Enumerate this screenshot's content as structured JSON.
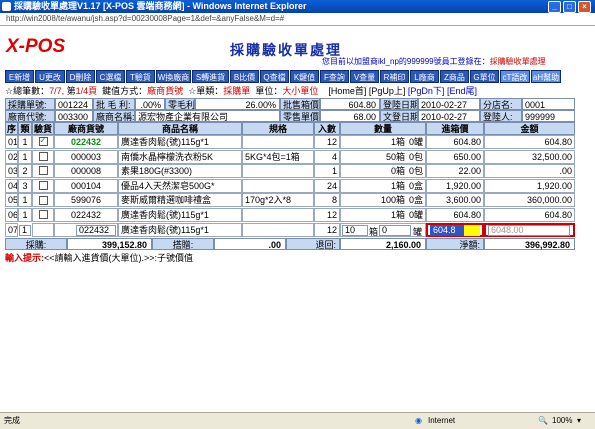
{
  "window": {
    "title": "採購驗收單處理V1.17 [X-POS 雲端商務網] - Windows Internet Explorer",
    "url": "http://win2008/te/awanu/jsh.asp?d=00230008Page=1&def=&anyFalse&M=d=#"
  },
  "app": {
    "logo": "X-POS",
    "title": "採購驗收單處理"
  },
  "login": {
    "prefix": "您目前以加盟商ikl_np的999999號員工登錄在：",
    "module": "採購驗收單處理"
  },
  "toolbar": [
    "E新增",
    "U更改",
    "D刪除",
    "C選檔",
    "T驗貨",
    "W換廠商",
    "S轉進貨",
    "B比價",
    "Q查檔",
    "K鍵值",
    "F查詢",
    "V查量",
    "R補印",
    "L廠商",
    "Z商品",
    "G單位",
    "cT語改",
    "aH幫助"
  ],
  "info": {
    "total_label": "☆總筆數：",
    "total_value": "7/7,",
    "page_label": "第",
    "page_value": "1/4頁",
    "key_label": "鍵值方式：",
    "key_value": "廠商貨號",
    "type_label": "☆單類：",
    "type_value": "採購單",
    "unit_label": "單位：",
    "unit_value": "大小單位",
    "nav": [
      "[Home首]",
      "[PgUp上]",
      "[PgDn下]",
      "[End尾]"
    ]
  },
  "header": {
    "row1": {
      "po_label": "採購單號:",
      "po_value": "001224",
      "margin_label": "批 毛 利:",
      "margin_value": ".00%",
      "retail_label": "零毛利:",
      "retail_value": "26.00%",
      "batch_label": "批售箱價",
      "batch_value": "604.80",
      "date_label": "登陸日期:",
      "date_value": "2010-02-27",
      "store_label": "分店名:",
      "store_value": "0001"
    },
    "row2": {
      "vendor_label": "廠商代號:",
      "vendor_value": "003300",
      "vname_label": "廠商名稱:",
      "vname_value": "源宏物產企業有限公司",
      "price_label": "零售單價",
      "price_value": "68.00",
      "doc_label": "文登日期:",
      "doc_value": "2010-02-27",
      "user_label": "登陸人:",
      "user_value": "999999"
    }
  },
  "columns": [
    "序",
    "類",
    "驗貨",
    "廠商貨號",
    "商品名稱",
    "規格",
    "入數",
    "數量",
    "進箱價",
    "金額"
  ],
  "rows": [
    {
      "seq": "01",
      "cls": "1",
      "checked": true,
      "code": "022432",
      "name": "廣達香肉鬆(號)115g*1",
      "spec": "",
      "pack": "12",
      "qty": "1箱",
      "qty2": "0罐",
      "price": "604.80",
      "amount": "604.80",
      "green": true
    },
    {
      "seq": "02",
      "cls": "1",
      "checked": false,
      "code": "000003",
      "name": "南僑水晶檸檬洗衣粉5K",
      "spec": "5KG*4包=1箱",
      "pack": "4",
      "qty": "50箱",
      "qty2": "0包",
      "price": "650.00",
      "amount": "32,500.00",
      "green": false
    },
    {
      "seq": "03",
      "cls": "2",
      "checked": false,
      "code": "000008",
      "name": "素果180G(#3300)",
      "spec": "",
      "pack": "1",
      "qty": "0箱",
      "qty2": "0包",
      "price": "22.00",
      "amount": ".00",
      "green": false
    },
    {
      "seq": "04",
      "cls": "3",
      "checked": false,
      "code": "000104",
      "name": "優品4入天然潔皂500G*",
      "spec": "",
      "pack": "24",
      "qty": "1箱",
      "qty2": "0盒",
      "price": "1,920.00",
      "amount": "1,920.00",
      "green": false
    },
    {
      "seq": "05",
      "cls": "1",
      "checked": false,
      "code": "599076",
      "name": "麥斯威爾精選咖啡禮盒",
      "spec": "170g*2入*8",
      "pack": "8",
      "qty": "100箱",
      "qty2": "0盒",
      "price": "3,600.00",
      "amount": "360,000.00",
      "green": false
    },
    {
      "seq": "06",
      "cls": "1",
      "checked": false,
      "code": "022432",
      "name": "廣達香肉鬆(號)115g*1",
      "spec": "",
      "pack": "12",
      "qty": "1箱",
      "qty2": "0罐",
      "price": "604.80",
      "amount": "604.80",
      "green": false
    }
  ],
  "edit_row": {
    "seq": "07",
    "cls": "1",
    "code": "022432",
    "name": "廣達香肉鬆(號)115g*1",
    "pack": "12",
    "qty": "10",
    "unit1": "箱",
    "qty2": "0",
    "unit2": "罐",
    "price": "604.8",
    "amount": "6048.00"
  },
  "summary": {
    "purchase_label": "採購:",
    "purchase_value": "399,152.80",
    "discount_label": "搭贈:",
    "discount_value": ".00",
    "return_label": "退回:",
    "return_value": "2,160.00",
    "net_label": "淨額:",
    "net_value": "396,992.80"
  },
  "tip": {
    "label": "輸入提示:",
    "text": "<<請輸入進貨價(大單位).>>:子號價值"
  },
  "status": {
    "left": "完成",
    "zone": "Internet",
    "zoom": "100%"
  }
}
